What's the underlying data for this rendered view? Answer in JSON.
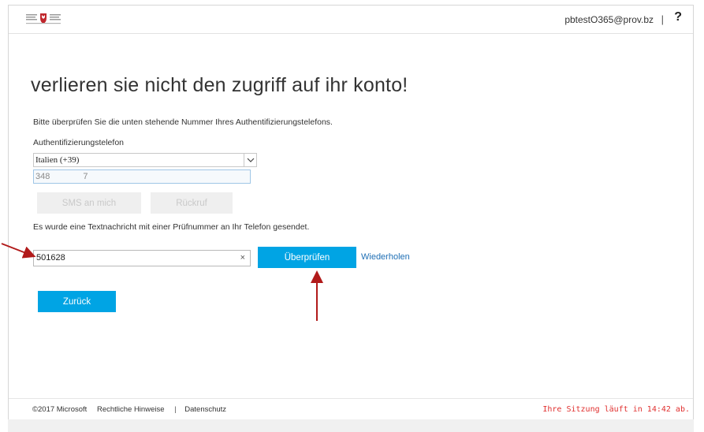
{
  "header": {
    "user_email": "pbtestO365@prov.bz",
    "divider": "|",
    "help_label": "?"
  },
  "main": {
    "title": "verlieren sie nicht den zugriff auf ihr konto!",
    "instructions": "Bitte überprüfen Sie die unten stehende Nummer Ihres Authentifizierungstelefons.",
    "phone_label": "Authentifizierungstelefon",
    "country_selected": "Italien (+39)",
    "phone_prefix": "348",
    "phone_suffix": "7",
    "sms_button_label": "SMS an mich",
    "callback_button_label": "Rückruf",
    "sms_sent_message": "Es wurde eine Textnachricht mit einer Prüfnummer an Ihr Telefon gesendet.",
    "code_value": "501628",
    "clear_icon": "×",
    "verify_button_label": "Überprüfen",
    "retry_link_label": "Wiederholen",
    "back_button_label": "Zurück"
  },
  "footer": {
    "copyright": "©2017 Microsoft",
    "legal_link": "Rechtliche Hinweise",
    "separator": "|",
    "privacy_link": "Datenschutz",
    "session_text": "Ihre Sitzung läuft in 14:42 ab."
  },
  "colors": {
    "accent": "#00a4e4",
    "annotation_arrow": "#b11a1a",
    "session_text": "#e0302f",
    "link": "#1f6fb5"
  }
}
